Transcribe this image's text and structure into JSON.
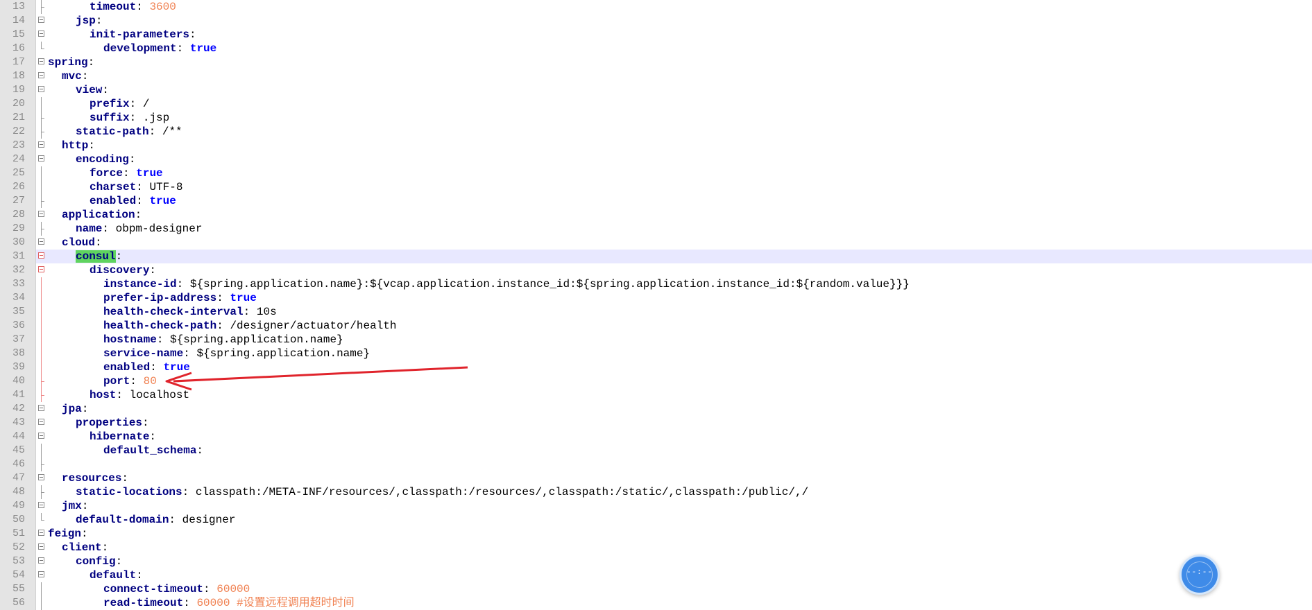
{
  "editor": {
    "current_line": 31,
    "lines": [
      {
        "n": "13",
        "indent": 3,
        "key": "timeout",
        "value": "3600",
        "vtype": "num",
        "fold": "tick"
      },
      {
        "n": "14",
        "indent": 2,
        "key": "jsp",
        "value": "",
        "vtype": "",
        "fold": "box"
      },
      {
        "n": "15",
        "indent": 3,
        "key": "init-parameters",
        "value": "",
        "vtype": "",
        "fold": "box"
      },
      {
        "n": "16",
        "indent": 4,
        "key": "development",
        "value": "true",
        "vtype": "bool",
        "fold": "end"
      },
      {
        "n": "17",
        "indent": 0,
        "key": "spring",
        "value": "",
        "vtype": "",
        "fold": "box"
      },
      {
        "n": "18",
        "indent": 1,
        "key": "mvc",
        "value": "",
        "vtype": "",
        "fold": "box"
      },
      {
        "n": "19",
        "indent": 2,
        "key": "view",
        "value": "",
        "vtype": "",
        "fold": "box"
      },
      {
        "n": "20",
        "indent": 3,
        "key": "prefix",
        "value": "/",
        "vtype": "str",
        "fold": "line"
      },
      {
        "n": "21",
        "indent": 3,
        "key": "suffix",
        "value": ".jsp",
        "vtype": "str",
        "fold": "tick"
      },
      {
        "n": "22",
        "indent": 2,
        "key": "static-path",
        "value": "/**",
        "vtype": "str",
        "fold": "tick"
      },
      {
        "n": "23",
        "indent": 1,
        "key": "http",
        "value": "",
        "vtype": "",
        "fold": "box"
      },
      {
        "n": "24",
        "indent": 2,
        "key": "encoding",
        "value": "",
        "vtype": "",
        "fold": "box"
      },
      {
        "n": "25",
        "indent": 3,
        "key": "force",
        "value": "true",
        "vtype": "bool",
        "fold": "line"
      },
      {
        "n": "26",
        "indent": 3,
        "key": "charset",
        "value": "UTF-8",
        "vtype": "str",
        "fold": "line"
      },
      {
        "n": "27",
        "indent": 3,
        "key": "enabled",
        "value": "true",
        "vtype": "bool",
        "fold": "tick"
      },
      {
        "n": "28",
        "indent": 1,
        "key": "application",
        "value": "",
        "vtype": "",
        "fold": "box"
      },
      {
        "n": "29",
        "indent": 2,
        "key": "name",
        "value": "obpm-designer",
        "vtype": "str",
        "fold": "tick"
      },
      {
        "n": "30",
        "indent": 1,
        "key": "cloud",
        "value": "",
        "vtype": "",
        "fold": "box"
      },
      {
        "n": "31",
        "indent": 2,
        "key": "consul",
        "value": "",
        "vtype": "",
        "fold": "box-red",
        "highlight": true
      },
      {
        "n": "32",
        "indent": 3,
        "key": "discovery",
        "value": "",
        "vtype": "",
        "fold": "box-red"
      },
      {
        "n": "33",
        "indent": 4,
        "key": "instance-id",
        "value": "${spring.application.name}:${vcap.application.instance_id:${spring.application.instance_id:${random.value}}}",
        "vtype": "str",
        "fold": "line-red"
      },
      {
        "n": "34",
        "indent": 4,
        "key": "prefer-ip-address",
        "value": "true",
        "vtype": "bool",
        "fold": "line-red"
      },
      {
        "n": "35",
        "indent": 4,
        "key": "health-check-interval",
        "value": "10s",
        "vtype": "str",
        "fold": "line-red"
      },
      {
        "n": "36",
        "indent": 4,
        "key": "health-check-path",
        "value": "/designer/actuator/health",
        "vtype": "str",
        "fold": "line-red"
      },
      {
        "n": "37",
        "indent": 4,
        "key": "hostname",
        "value": "${spring.application.name}",
        "vtype": "str",
        "fold": "line-red"
      },
      {
        "n": "38",
        "indent": 4,
        "key": "service-name",
        "value": "${spring.application.name}",
        "vtype": "str",
        "fold": "line-red"
      },
      {
        "n": "39",
        "indent": 4,
        "key": "enabled",
        "value": "true",
        "vtype": "bool",
        "fold": "line-red"
      },
      {
        "n": "40",
        "indent": 4,
        "key": "port",
        "value": "80",
        "vtype": "num",
        "fold": "tick-red"
      },
      {
        "n": "41",
        "indent": 3,
        "key": "host",
        "value": "localhost",
        "vtype": "str",
        "fold": "tick-red"
      },
      {
        "n": "42",
        "indent": 1,
        "key": "jpa",
        "value": "",
        "vtype": "",
        "fold": "box"
      },
      {
        "n": "43",
        "indent": 2,
        "key": "properties",
        "value": "",
        "vtype": "",
        "fold": "box"
      },
      {
        "n": "44",
        "indent": 3,
        "key": "hibernate",
        "value": "",
        "vtype": "",
        "fold": "box"
      },
      {
        "n": "45",
        "indent": 4,
        "key": "default_schema",
        "value": "",
        "vtype": "str",
        "fold": "line"
      },
      {
        "n": "46",
        "indent": 0,
        "key": "",
        "value": "",
        "vtype": "",
        "fold": "tick"
      },
      {
        "n": "47",
        "indent": 1,
        "key": "resources",
        "value": "",
        "vtype": "",
        "fold": "box"
      },
      {
        "n": "48",
        "indent": 2,
        "key": "static-locations",
        "value": "classpath:/META-INF/resources/,classpath:/resources/,classpath:/static/,classpath:/public/,/",
        "vtype": "str",
        "fold": "tick"
      },
      {
        "n": "49",
        "indent": 1,
        "key": "jmx",
        "value": "",
        "vtype": "",
        "fold": "box"
      },
      {
        "n": "50",
        "indent": 2,
        "key": "default-domain",
        "value": "designer",
        "vtype": "str",
        "fold": "end"
      },
      {
        "n": "51",
        "indent": 0,
        "key": "feign",
        "value": "",
        "vtype": "",
        "fold": "box"
      },
      {
        "n": "52",
        "indent": 1,
        "key": "client",
        "value": "",
        "vtype": "",
        "fold": "box"
      },
      {
        "n": "53",
        "indent": 2,
        "key": "config",
        "value": "",
        "vtype": "",
        "fold": "box"
      },
      {
        "n": "54",
        "indent": 3,
        "key": "default",
        "value": "",
        "vtype": "",
        "fold": "box"
      },
      {
        "n": "55",
        "indent": 4,
        "key": "connect-timeout",
        "value": "60000",
        "vtype": "num",
        "fold": "line"
      },
      {
        "n": "56",
        "indent": 4,
        "key": "read-timeout",
        "value": "60000 #设置远程调用超时时间",
        "vtype": "num",
        "fold": "line"
      }
    ]
  },
  "annotation": {
    "color": "#e0242c",
    "target_line": 40
  },
  "floating_button": {
    "glyph": "--:--"
  },
  "colors": {
    "gutter_bg": "#e4e4e4",
    "current_line_bg": "#e8e8ff",
    "key": "#000080",
    "bool": "#0000ff",
    "number": "#f08050",
    "highlight": "#5fd35f"
  }
}
